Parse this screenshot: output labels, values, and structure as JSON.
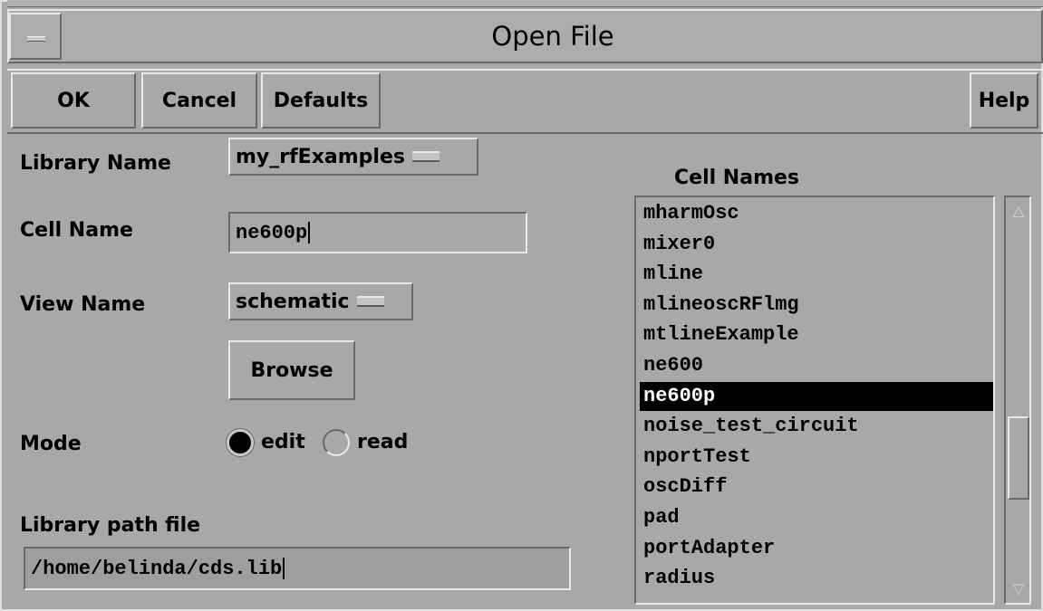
{
  "window": {
    "title": "Open File"
  },
  "toolbar": {
    "ok": "OK",
    "cancel": "Cancel",
    "defaults": "Defaults",
    "help": "Help"
  },
  "form": {
    "library_label": "Library Name",
    "library_value": "my_rfExamples",
    "cell_label": "Cell Name",
    "cell_value": "ne600p",
    "view_label": "View Name",
    "view_value": "schematic",
    "browse": "Browse",
    "mode_label": "Mode",
    "mode_edit": "edit",
    "mode_read": "read",
    "mode_selected": "edit",
    "libpath_label": "Library path file",
    "libpath_value": "/home/belinda/cds.lib"
  },
  "cells": {
    "header": "Cell Names",
    "selected": "ne600p",
    "items": [
      "mharmOsc",
      "mixer0",
      "mline",
      "mlineoscRFlmg",
      "mtlineExample",
      "ne600",
      "ne600p",
      "noise_test_circuit",
      "nportTest",
      "oscDiff",
      "pad",
      "portAdapter",
      "radius"
    ]
  },
  "icons": {
    "window_menu": "window-menu-icon",
    "scroll_up": "scroll-up-arrow-icon",
    "scroll_down": "scroll-down-arrow-icon"
  }
}
